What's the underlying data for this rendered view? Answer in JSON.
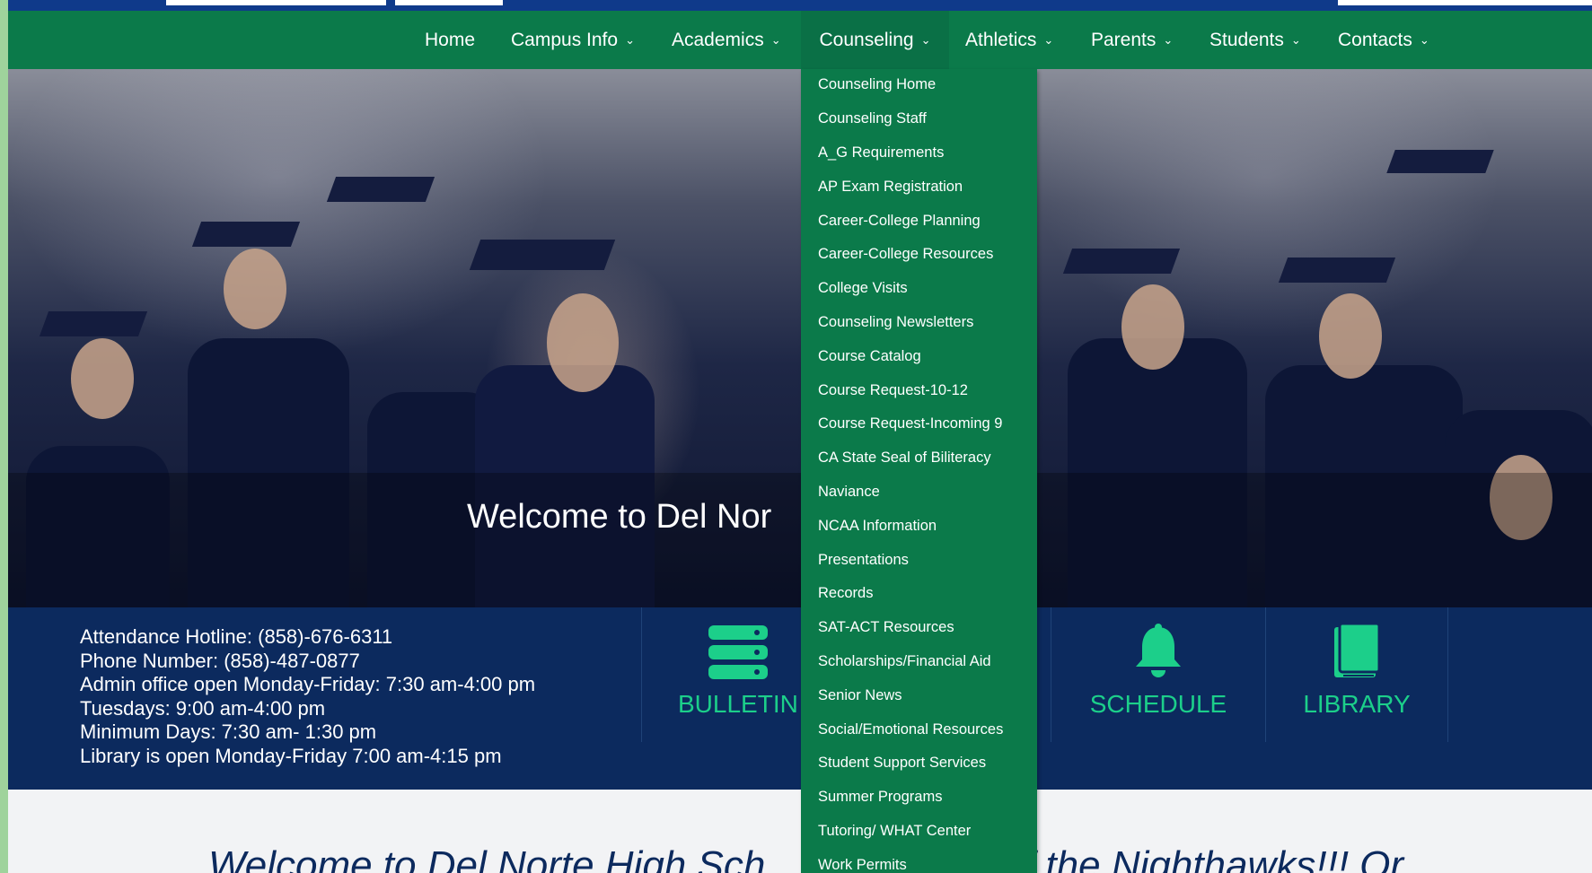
{
  "nav": {
    "items": [
      {
        "label": "Home",
        "has_menu": false
      },
      {
        "label": "Campus Info",
        "has_menu": true
      },
      {
        "label": "Academics",
        "has_menu": true
      },
      {
        "label": "Counseling",
        "has_menu": true,
        "active": true
      },
      {
        "label": "Athletics",
        "has_menu": true
      },
      {
        "label": "Parents",
        "has_menu": true
      },
      {
        "label": "Students",
        "has_menu": true
      },
      {
        "label": "Contacts",
        "has_menu": true
      }
    ],
    "chevron": "⌄"
  },
  "dropdown": {
    "items": [
      "Counseling Home",
      "Counseling Staff",
      "A_G Requirements",
      "AP Exam Registration",
      "Career-College Planning",
      "Career-College Resources",
      "College Visits",
      "Counseling Newsletters",
      "Course Catalog",
      "Course Request-10-12",
      "Course Request-Incoming 9",
      "CA State Seal of Biliteracy",
      "Naviance",
      "NCAA Information",
      "Presentations",
      "Records",
      "SAT-ACT Resources",
      "Scholarships/Financial Aid",
      "Senior News",
      "Social/Emotional Resources",
      "Student Support Services",
      "Summer Programs",
      "Tutoring/ WHAT Center",
      "Work Permits"
    ]
  },
  "hero": {
    "title": "Welcome to Del Nor"
  },
  "info": {
    "lines": [
      "Attendance Hotline: (858)-676-6311",
      "Phone Number: (858)-487-0877",
      "Admin office open Monday-Friday: 7:30 am-4:00 pm",
      "Tuesdays: 9:00 am-4:00 pm",
      "Minimum Days: 7:30 am- 1:30 pm",
      "Library is open Monday-Friday 7:00 am-4:15 pm"
    ]
  },
  "tiles": [
    {
      "label": "BULLETIN",
      "icon": "server-icon"
    },
    {
      "label": "SCHEDULE",
      "icon": "bell-icon"
    },
    {
      "label": "LIBRARY",
      "icon": "book-icon"
    }
  ],
  "welcome": {
    "left": "Welcome to Del Norte High Sch",
    "right": "f the Nighthawks!!! Or"
  },
  "colors": {
    "nav_green": "#0b7a4a",
    "info_blue": "#0c2a5e",
    "tile_green": "#1ccf8a",
    "top_strip": "#0f3a8a"
  }
}
